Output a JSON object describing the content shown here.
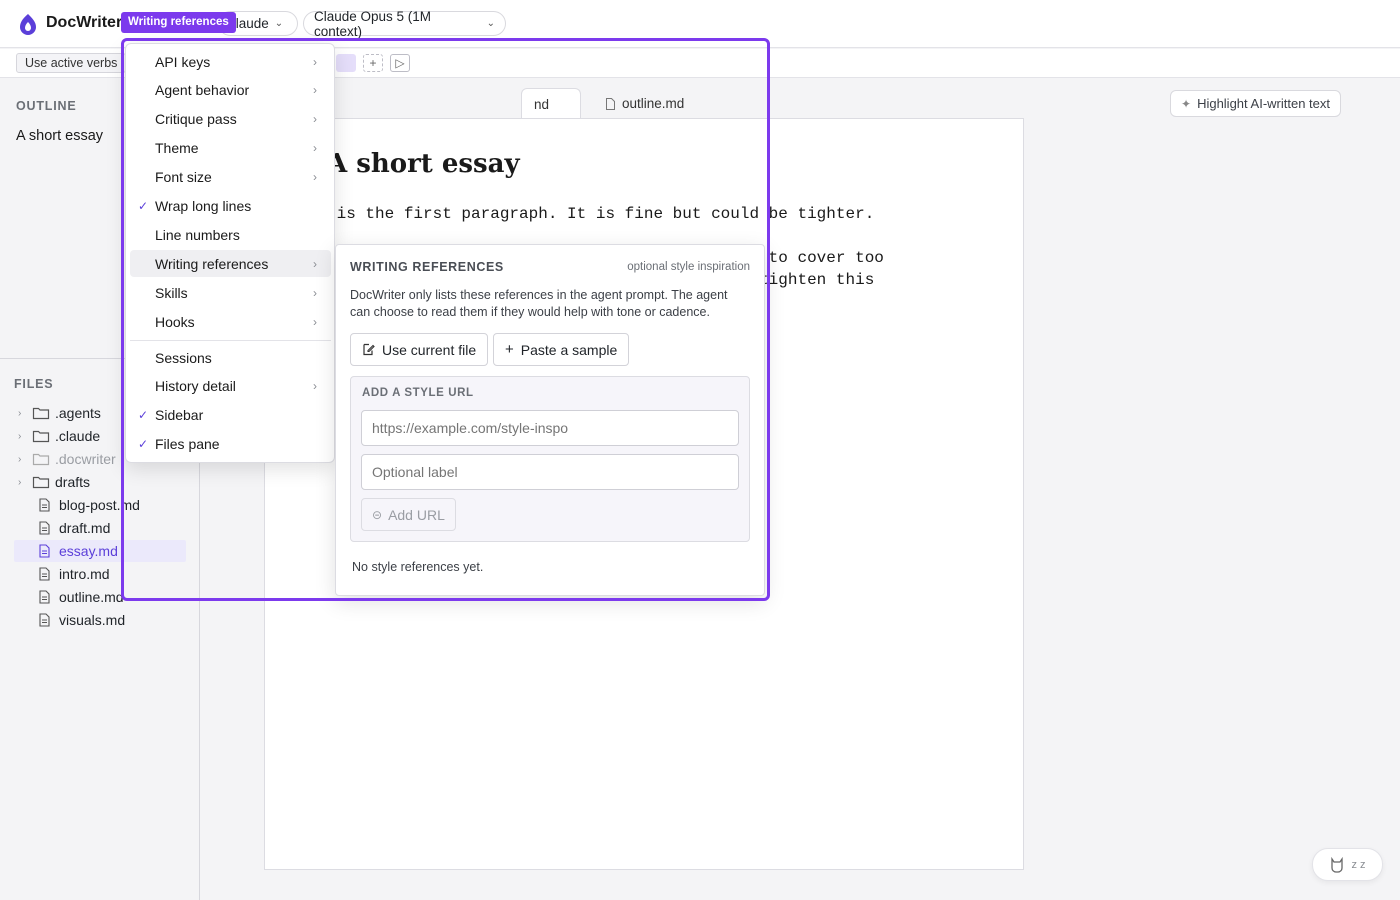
{
  "app": {
    "title": "DocWriter",
    "brand_color": "#5b3fd9",
    "highlight_color": "#7c3aed"
  },
  "topbar": {
    "agent_selector": "claude",
    "model_selector": "Claude Opus 5 (1M context)"
  },
  "subbar": {
    "chip_label": "Use active verbs",
    "add_symbol": "+",
    "run_symbol": "▷"
  },
  "highlight_tag": "Writing references",
  "outline": {
    "label": "OUTLINE",
    "items": [
      "A short essay"
    ]
  },
  "files": {
    "label": "FILES",
    "folders": [
      ".agents",
      ".claude",
      ".docwriter",
      "drafts"
    ],
    "items": [
      "blog-post.md",
      "draft.md",
      "essay.md",
      "intro.md",
      "outline.md",
      "visuals.md"
    ],
    "selected": "essay.md"
  },
  "tabs": {
    "active_partial": "nd",
    "second": "outline.md"
  },
  "highlight_button": "Highlight AI-written text",
  "document": {
    "title": "A short essay",
    "line1": " is the first paragraph. It is fine but could be tighter.",
    "line2": "                                          ies to cover too",
    "line3": "                                        . [[ tighten this",
    "line4": "                                        ]]"
  },
  "menu": {
    "items": [
      {
        "label": "API keys",
        "submenu": true,
        "checked": false
      },
      {
        "label": "Agent behavior",
        "submenu": true,
        "checked": false
      },
      {
        "label": "Critique pass",
        "submenu": true,
        "checked": false
      },
      {
        "label": "Theme",
        "submenu": true,
        "checked": false
      },
      {
        "label": "Font size",
        "submenu": true,
        "checked": false
      },
      {
        "label": "Wrap long lines",
        "submenu": false,
        "checked": true
      },
      {
        "label": "Line numbers",
        "submenu": false,
        "checked": false
      },
      {
        "label": "Writing references",
        "submenu": true,
        "checked": false
      },
      {
        "label": "Skills",
        "submenu": true,
        "checked": false
      },
      {
        "label": "Hooks",
        "submenu": true,
        "checked": false
      },
      {
        "label": "Sessions",
        "submenu": false,
        "checked": false
      },
      {
        "label": "History detail",
        "submenu": true,
        "checked": false
      },
      {
        "label": "Sidebar",
        "submenu": false,
        "checked": true
      },
      {
        "label": "Files pane",
        "submenu": false,
        "checked": true
      }
    ]
  },
  "panel": {
    "title": "WRITING REFERENCES",
    "hint": "optional style inspiration",
    "description": "DocWriter only lists these references in the agent prompt. The agent can choose to read them if they would help with tone or cadence.",
    "use_current_file": "Use current file",
    "paste_sample": "Paste a sample",
    "url_section_title": "ADD A STYLE URL",
    "url_placeholder": "https://example.com/style-inspo",
    "label_placeholder": "Optional label",
    "add_url": "Add URL",
    "empty_note": "No style references yet."
  },
  "widget": {
    "status": "z z"
  }
}
